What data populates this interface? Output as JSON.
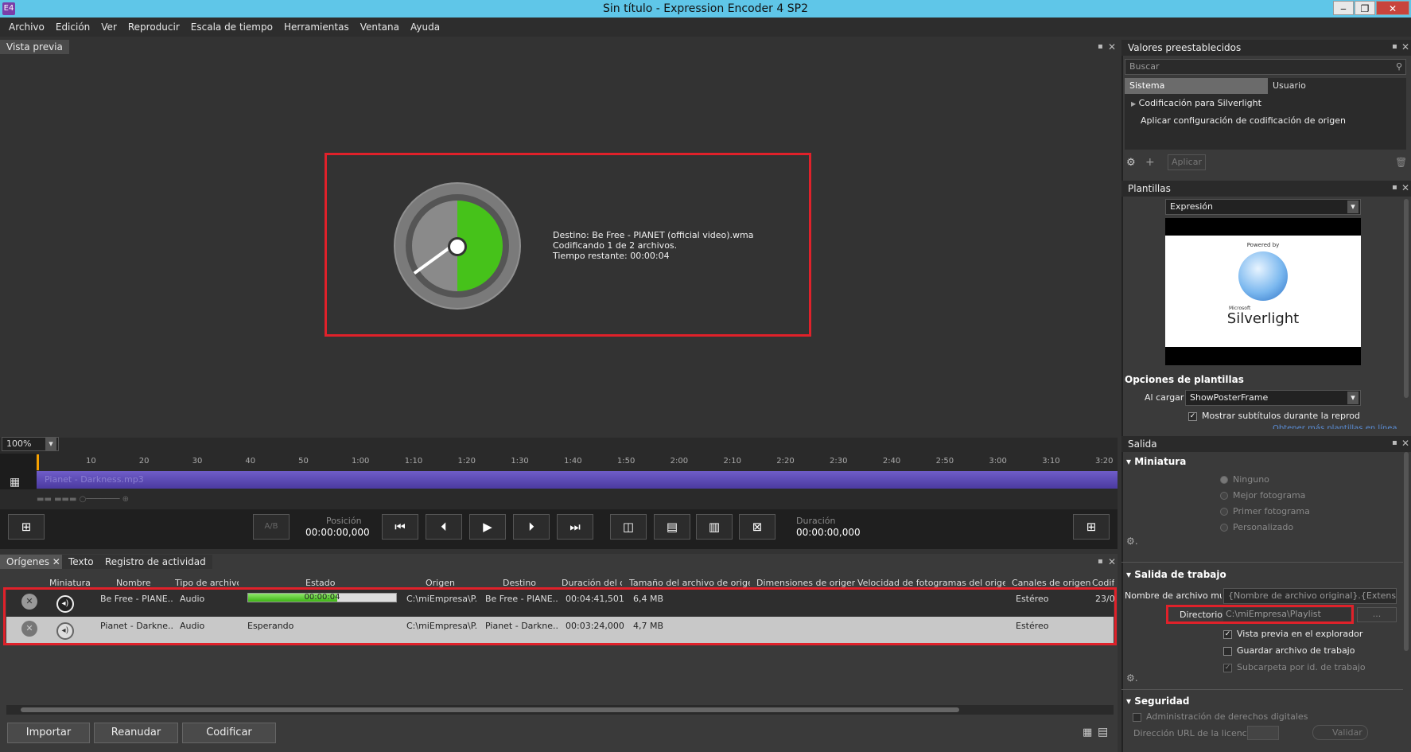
{
  "window": {
    "title": "Sin título - Expression Encoder 4 SP2",
    "app_icon": "E4"
  },
  "menu": [
    "Archivo",
    "Edición",
    "Ver",
    "Reproducir",
    "Escala de tiempo",
    "Herramientas",
    "Ventana",
    "Ayuda"
  ],
  "preview": {
    "tab": "Vista previa",
    "encoding_lines": [
      "Destino: Be Free - PIANET (official video).wma",
      "Codificando 1 de 2 archivos.",
      "Tiempo restante: 00:00:04"
    ]
  },
  "timeline": {
    "zoom": "100%",
    "ticks": [
      "10",
      "20",
      "30",
      "40",
      "50",
      "1:00",
      "1:10",
      "1:20",
      "1:30",
      "1:40",
      "1:50",
      "2:00",
      "2:10",
      "2:20",
      "2:30",
      "2:40",
      "2:50",
      "3:00",
      "3:10",
      "3:20"
    ],
    "track_label": "Pianet - Darkness.mp3"
  },
  "controls": {
    "ab_label": "A/B",
    "position_label": "Posición",
    "position_value": "00:00:00,000",
    "duration_label": "Duración",
    "duration_value": "00:00:00,000"
  },
  "presets": {
    "title": "Valores preestablecidos",
    "search_placeholder": "Buscar",
    "tabs": [
      "Sistema",
      "Usuario"
    ],
    "items": [
      "Codificación para Silverlight",
      "Aplicar configuración de codificación de origen"
    ],
    "apply_label": "Aplicar"
  },
  "templates": {
    "title": "Plantillas",
    "selected": "Expresión",
    "thumbnail_text": {
      "powered": "Powered by",
      "microsoft": "Microsoft",
      "brand": "Silverlight"
    },
    "options_title": "Opciones de plantillas",
    "on_load_label": "Al cargar",
    "on_load_value": "ShowPosterFrame",
    "subtitles_label": "Mostrar subtítulos durante la reproducc",
    "more_link": "Obtener más plantillas en línea"
  },
  "output": {
    "title": "Salida",
    "thumbnail_section": "Miniatura",
    "thumbnail_options": [
      "Ninguno",
      "Mejor fotograma",
      "Primer fotograma",
      "Personalizado"
    ],
    "job_output_section": "Salida de trabajo",
    "filename_label": "Nombre de archivo mul",
    "filename_value": "{Nombre de archivo original}.{Extensió",
    "directory_label": "Directorio",
    "directory_value": "C:\\miEmpresa\\Playlist",
    "browse_label": "...",
    "preview_explorer": "Vista previa en el explorador",
    "save_job": "Guardar archivo de trabajo",
    "subfolder": "Subcarpeta por id. de trabajo",
    "security_section": "Seguridad",
    "drm_label": "Administración de derechos digitales",
    "license_url_label": "Dirección URL de la licencia",
    "validate_label": "Validar"
  },
  "jobs": {
    "tabs": [
      "Orígenes",
      "Texto",
      "Registro de actividad"
    ],
    "columns": [
      "Miniatura",
      "Nombre",
      "Tipo de archivo",
      "Estado",
      "Origen",
      "Destino",
      "Duración del o",
      "Tamaño del archivo de origen",
      "Dimensiones de origen",
      "Velocidad de fotogramas del origen",
      "Canales de origen",
      "Codif"
    ],
    "rows": [
      {
        "name": "Be Free - PIANE...",
        "type": "Audio",
        "status": "00:00:04",
        "progress": 0.6,
        "origin": "C:\\miEmpresa\\P...",
        "dest": "Be Free - PIANE...",
        "duration": "00:04:41,501",
        "size": "6,4 MB",
        "channels": "Estéreo",
        "codif": "23/0"
      },
      {
        "name": "Pianet - Darkne...",
        "type": "Audio",
        "status": "Esperando",
        "origin": "C:\\miEmpresa\\P...",
        "dest": "Pianet - Darkne...",
        "duration": "00:03:24,000",
        "size": "4,7 MB",
        "channels": "Estéreo",
        "codif": ""
      }
    ],
    "buttons": {
      "import": "Importar",
      "resume": "Reanudar",
      "encode": "Codificar"
    }
  },
  "colors": {
    "accent_red": "#e0212a",
    "progress_green": "#46c21a",
    "titlebar": "#5fc6e8",
    "track": "#5a48b8"
  }
}
